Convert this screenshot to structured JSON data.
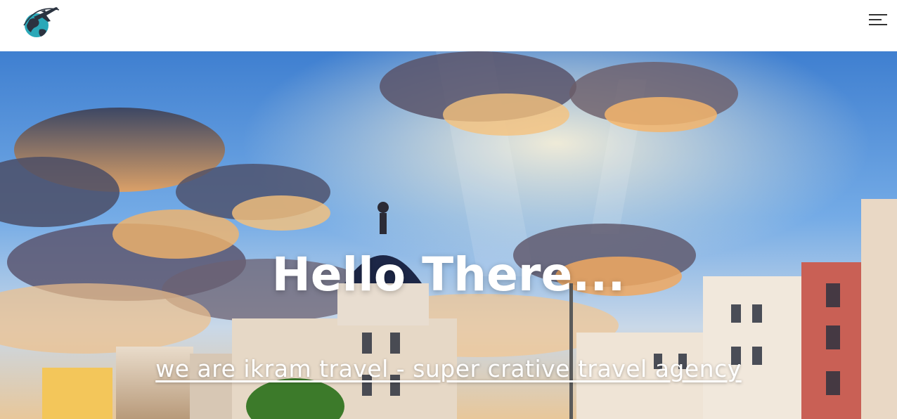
{
  "header": {
    "logo_icon": "airplane-globe-logo-icon",
    "menu_icon": "hamburger-menu-icon"
  },
  "hero": {
    "title": "Hello There...",
    "subtitle": "we are ikram travel - super crative travel agency",
    "background": "madrid-city-sky-photo"
  },
  "colors": {
    "header_bg": "#ffffff",
    "text": "#ffffff",
    "menu_lines": "#333333",
    "logo_teal": "#2aa8b8",
    "logo_dark": "#2b3340"
  }
}
